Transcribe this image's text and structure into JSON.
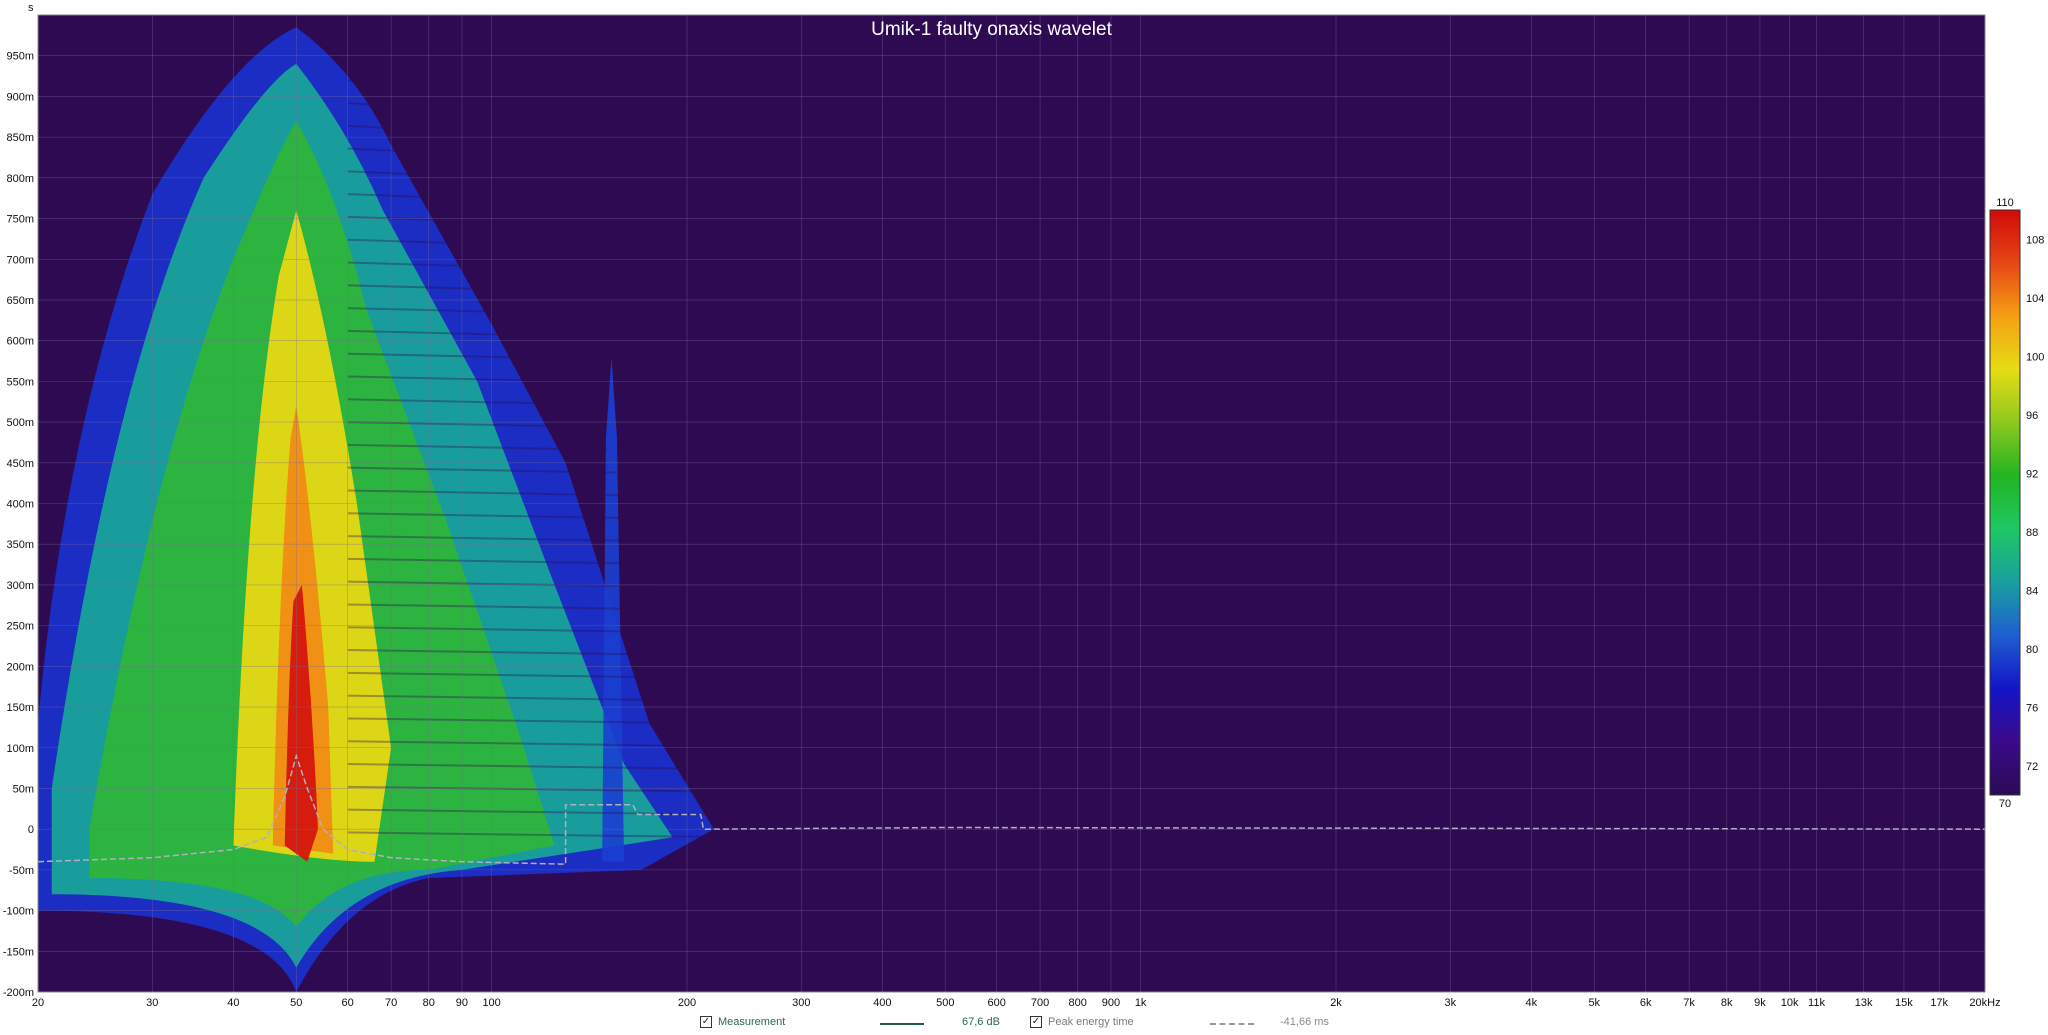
{
  "chart_data": {
    "type": "heatmap",
    "title": "Umik-1 faulty onaxis wavelet",
    "y_unit_label": "s",
    "x_unit_label": "20kHz",
    "x_scale": "log",
    "xlim": [
      20,
      20000
    ],
    "ylim": [
      -0.2,
      1.0
    ],
    "x_ticks": [
      {
        "v": 20,
        "label": "20",
        "strong": true
      },
      {
        "v": 30,
        "label": "30",
        "strong": true
      },
      {
        "v": 40,
        "label": "40",
        "strong": true
      },
      {
        "v": 50,
        "label": "50",
        "strong": true
      },
      {
        "v": 60,
        "label": "60",
        "strong": true
      },
      {
        "v": 70,
        "label": "70",
        "strong": true
      },
      {
        "v": 80,
        "label": "80",
        "strong": true
      },
      {
        "v": 90,
        "label": "90",
        "strong": true
      },
      {
        "v": 100,
        "label": "100",
        "strong": true
      },
      {
        "v": 200,
        "label": "200",
        "strong": true
      },
      {
        "v": 300,
        "label": "300",
        "strong": true
      },
      {
        "v": 400,
        "label": "400",
        "strong": true
      },
      {
        "v": 500,
        "label": "500",
        "strong": true
      },
      {
        "v": 600,
        "label": "600",
        "strong": true
      },
      {
        "v": 700,
        "label": "700",
        "strong": true
      },
      {
        "v": 800,
        "label": "800",
        "strong": true
      },
      {
        "v": 900,
        "label": "900",
        "strong": true
      },
      {
        "v": 1000,
        "label": "1k",
        "strong": true
      },
      {
        "v": 2000,
        "label": "2k",
        "strong": true
      },
      {
        "v": 3000,
        "label": "3k",
        "strong": true
      },
      {
        "v": 4000,
        "label": "4k",
        "strong": true
      },
      {
        "v": 5000,
        "label": "5k",
        "strong": true
      },
      {
        "v": 6000,
        "label": "6k",
        "strong": true
      },
      {
        "v": 7000,
        "label": "7k",
        "strong": true
      },
      {
        "v": 8000,
        "label": "8k",
        "strong": true
      },
      {
        "v": 9000,
        "label": "9k",
        "strong": true
      },
      {
        "v": 10000,
        "label": "10k",
        "strong": true
      },
      {
        "v": 11000,
        "label": "11k",
        "strong": false
      },
      {
        "v": 13000,
        "label": "13k",
        "strong": false
      },
      {
        "v": 15000,
        "label": "15k",
        "strong": false
      },
      {
        "v": 17000,
        "label": "17k",
        "strong": false
      }
    ],
    "y_ticks": [
      {
        "v": 0.95,
        "label": "950m"
      },
      {
        "v": 0.9,
        "label": "900m"
      },
      {
        "v": 0.85,
        "label": "850m"
      },
      {
        "v": 0.8,
        "label": "800m"
      },
      {
        "v": 0.75,
        "label": "750m"
      },
      {
        "v": 0.7,
        "label": "700m"
      },
      {
        "v": 0.65,
        "label": "650m"
      },
      {
        "v": 0.6,
        "label": "600m"
      },
      {
        "v": 0.55,
        "label": "550m"
      },
      {
        "v": 0.5,
        "label": "500m"
      },
      {
        "v": 0.45,
        "label": "450m"
      },
      {
        "v": 0.4,
        "label": "400m"
      },
      {
        "v": 0.35,
        "label": "350m"
      },
      {
        "v": 0.3,
        "label": "300m"
      },
      {
        "v": 0.25,
        "label": "250m"
      },
      {
        "v": 0.2,
        "label": "200m"
      },
      {
        "v": 0.15,
        "label": "150m"
      },
      {
        "v": 0.1,
        "label": "100m"
      },
      {
        "v": 0.05,
        "label": "50m"
      },
      {
        "v": 0.0,
        "label": "0"
      },
      {
        "v": -0.05,
        "label": "-50m"
      },
      {
        "v": -0.1,
        "label": "-100m"
      },
      {
        "v": -0.15,
        "label": "-150m"
      },
      {
        "v": -0.2,
        "label": "-200m"
      }
    ],
    "grid": true,
    "colorbar": {
      "min": 70,
      "max": 110,
      "ticks": [
        {
          "v": 110,
          "label": "110"
        },
        {
          "v": 108,
          "label": "108"
        },
        {
          "v": 104,
          "label": "104"
        },
        {
          "v": 100,
          "label": "100"
        },
        {
          "v": 96,
          "label": "96"
        },
        {
          "v": 92,
          "label": "92"
        },
        {
          "v": 88,
          "label": "88"
        },
        {
          "v": 84,
          "label": "84"
        },
        {
          "v": 80,
          "label": "80"
        },
        {
          "v": 76,
          "label": "76"
        },
        {
          "v": 72,
          "label": "72"
        },
        {
          "v": 70,
          "label": "70"
        }
      ],
      "stops": [
        "#2b0a55",
        "#3a0a8a",
        "#1414c8",
        "#1f5fd0",
        "#19a0a0",
        "#1ec864",
        "#22b422",
        "#8cc81e",
        "#e6dc14",
        "#f5a014",
        "#e64614",
        "#d20a0a"
      ]
    },
    "background_color": "#2e0a52",
    "peak_energy_time": [
      [
        20,
        -0.04
      ],
      [
        30,
        -0.035
      ],
      [
        40,
        -0.025
      ],
      [
        45,
        -0.01
      ],
      [
        48,
        0.04
      ],
      [
        50,
        0.09
      ],
      [
        52,
        0.05
      ],
      [
        55,
        0.0
      ],
      [
        60,
        -0.025
      ],
      [
        70,
        -0.035
      ],
      [
        90,
        -0.04
      ],
      [
        130,
        -0.043
      ],
      [
        130,
        0.03
      ],
      [
        165,
        0.03
      ],
      [
        168,
        0.018
      ],
      [
        210,
        0.018
      ],
      [
        212,
        0.0
      ],
      [
        500,
        0.002
      ],
      [
        20000,
        0.0
      ]
    ],
    "series": [
      {
        "name": "Measurement",
        "value_label": "67,6 dB",
        "color": "#1f5f3f",
        "checked": true
      },
      {
        "name": "Peak energy time",
        "value_label": "-41,66 ms",
        "color": "#9a9a9a",
        "checked": true
      }
    ]
  }
}
